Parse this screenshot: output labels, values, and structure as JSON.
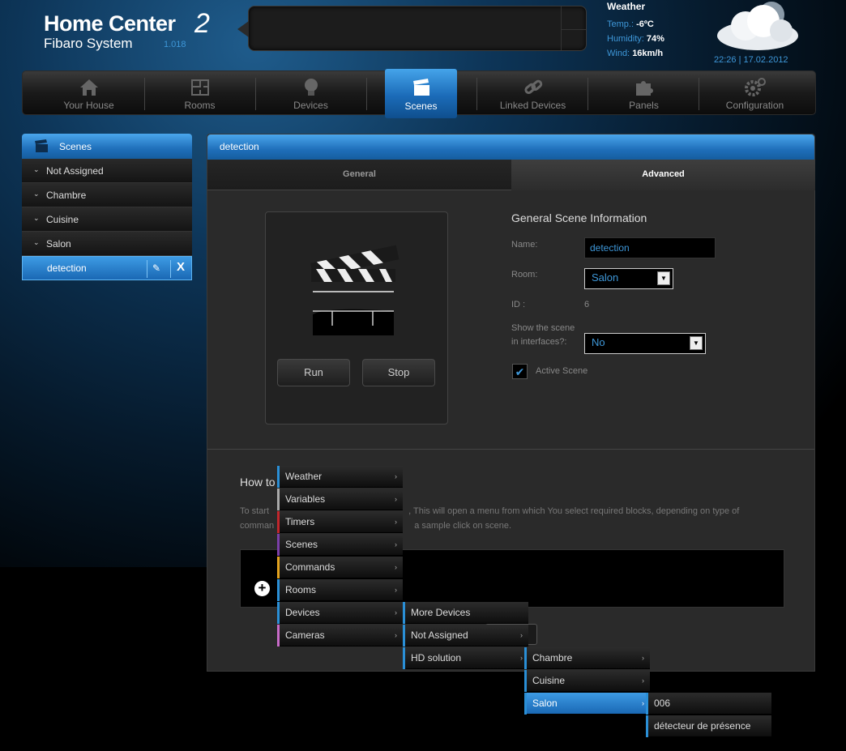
{
  "header": {
    "title": "Home Center",
    "title_num": "2",
    "subtitle": "Fibaro System",
    "version": "1.018"
  },
  "weather": {
    "title": "Weather",
    "temp_label": "Temp.:",
    "temp_value": "-6ºC",
    "humidity_label": "Humidity:",
    "humidity_value": "74%",
    "wind_label": "Wind:",
    "wind_value": "16km/h",
    "datetime": "22:26 | 17.02.2012",
    "icon": "cloud-icon"
  },
  "nav": [
    {
      "label": "Your House",
      "icon": "house-icon"
    },
    {
      "label": "Rooms",
      "icon": "floorplan-icon"
    },
    {
      "label": "Devices",
      "icon": "bulb-icon"
    },
    {
      "label": "Scenes",
      "icon": "clapper-icon",
      "active": true
    },
    {
      "label": "Linked Devices",
      "icon": "chain-link-icon"
    },
    {
      "label": "Panels",
      "icon": "puzzle-icon"
    },
    {
      "label": "Configuration",
      "icon": "gears-icon"
    }
  ],
  "sidebar": {
    "title": "Scenes",
    "groups": [
      {
        "label": "Not Assigned"
      },
      {
        "label": "Chambre"
      },
      {
        "label": "Cuisine"
      },
      {
        "label": "Salon"
      }
    ],
    "selected": {
      "label": "detection",
      "edit_icon": "pencil-icon",
      "delete_label": "X"
    }
  },
  "scene": {
    "header": "detection",
    "tabs": {
      "general": "General",
      "advanced": "Advanced"
    },
    "run_label": "Run",
    "stop_label": "Stop",
    "info_title": "General Scene Information",
    "name_label": "Name:",
    "name_value": "detection",
    "room_label": "Room:",
    "room_value": "Salon",
    "id_label": "ID :",
    "id_value": "6",
    "show_label_1": "Show the scene",
    "show_label_2": "in interfaces?:",
    "show_value": "No",
    "active_label": "Active Scene",
    "active_checked": true
  },
  "howto": {
    "title_visible": "How to",
    "desc_line1_left": "To start",
    "desc_line1_right": ", This will open a menu from which You select required blocks, depending on type of",
    "desc_line2_left": "comman",
    "desc_line2_right": "a sample click on scene."
  },
  "menus": {
    "level1": [
      {
        "label": "Weather",
        "color": "#2a8fd6"
      },
      {
        "label": "Variables",
        "color": "#aaaaaa"
      },
      {
        "label": "Timers",
        "color": "#c0262c"
      },
      {
        "label": "Scenes",
        "color": "#7b3fa8"
      },
      {
        "label": "Commands",
        "color": "#e2a21e"
      },
      {
        "label": "Rooms",
        "color": "#2a8fd6"
      },
      {
        "label": "Devices",
        "color": "#2a8fd6"
      },
      {
        "label": "Cameras",
        "color": "#c86bc8"
      }
    ],
    "level2": [
      {
        "label": "More Devices"
      },
      {
        "label": "Not Assigned"
      },
      {
        "label": "HD solution"
      }
    ],
    "level3": [
      {
        "label": "Chambre"
      },
      {
        "label": "Cuisine"
      },
      {
        "label": "Salon",
        "selected": true
      }
    ],
    "level4": [
      {
        "label": "006"
      },
      {
        "label": "détecteur de présence"
      }
    ]
  },
  "colors": {
    "accent": "#1f6fba",
    "accent_light": "#3e97d8"
  }
}
